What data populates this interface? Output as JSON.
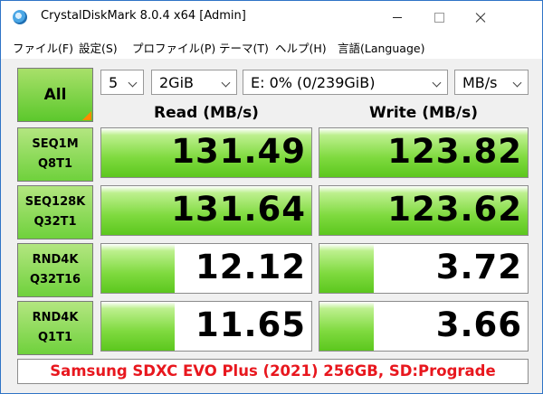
{
  "window": {
    "title": "CrystalDiskMark 8.0.4 x64 [Admin]"
  },
  "menu": [
    "ファイル(F)",
    "設定(S)",
    "プロファイル(P)",
    "テーマ(T)",
    "ヘルプ(H)",
    "言語(Language)"
  ],
  "controls": {
    "all_label": "All",
    "count": "5",
    "size": "2GiB",
    "drive": "E: 0% (0/239GiB)",
    "unit": "MB/s"
  },
  "headers": {
    "read": "Read (MB/s)",
    "write": "Write (MB/s)"
  },
  "tests": [
    {
      "line1": "SEQ1M",
      "line2": "Q8T1",
      "read": "131.49",
      "write": "123.82",
      "read_fill": 1.0,
      "write_fill": 1.0
    },
    {
      "line1": "SEQ128K",
      "line2": "Q32T1",
      "read": "131.64",
      "write": "123.62",
      "read_fill": 1.0,
      "write_fill": 1.0
    },
    {
      "line1": "RND4K",
      "line2": "Q32T16",
      "read": "12.12",
      "write": "3.72",
      "read_fill": 0.35,
      "write_fill": 0.26
    },
    {
      "line1": "RND4K",
      "line2": "Q1T1",
      "read": "11.65",
      "write": "3.66",
      "read_fill": 0.35,
      "write_fill": 0.26
    }
  ],
  "comment": "Samsung SDXC EVO Plus (2021) 256GB, SD:Prograde",
  "colors": {
    "accent_green": "#5cc82c",
    "comment_red": "#e8171e",
    "corner_orange": "#ff8a00"
  }
}
